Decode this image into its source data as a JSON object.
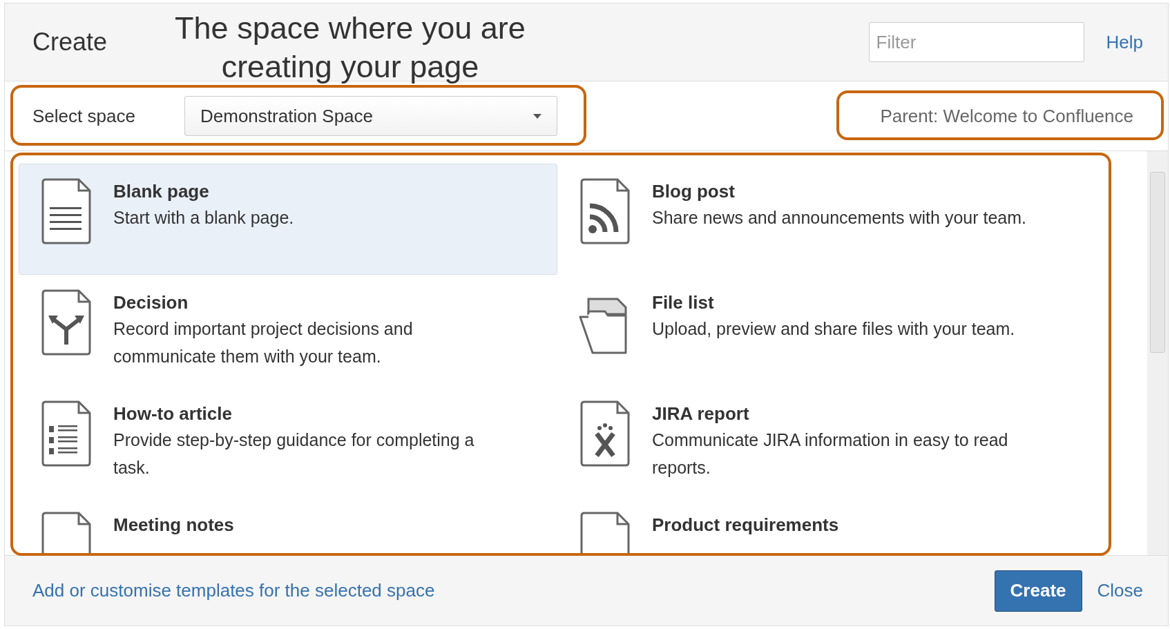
{
  "dialog": {
    "title": "Create",
    "filter": {
      "placeholder": "Filter"
    },
    "help": "Help"
  },
  "annotation": {
    "lines": [
      "The space where you are",
      "creating your page"
    ]
  },
  "space_row": {
    "label": "Select space",
    "space": "Demonstration Space",
    "parent": "Parent: Welcome to Confluence"
  },
  "templates": [
    {
      "title": "Blank page",
      "description": "Start with a blank page.",
      "selected": true
    },
    {
      "title": "Blog post",
      "description": "Share news and announcements with your team.",
      "selected": false
    },
    {
      "title": "Decision",
      "description": "Record important project decisions and communicate them with your team.",
      "selected": false
    },
    {
      "title": "File list",
      "description": "Upload, preview and share files with your team.",
      "selected": false
    },
    {
      "title": "How-to article",
      "description": "Provide step-by-step guidance for completing a task.",
      "selected": false
    },
    {
      "title": "JIRA report",
      "description": "Communicate JIRA information in easy to read reports.",
      "selected": false
    },
    {
      "title": "Meeting notes",
      "selected": false
    },
    {
      "title": "Product requirements",
      "selected": false
    }
  ],
  "footer": {
    "link": "Add or customise templates for the selected space",
    "primary": "Create",
    "close": "Close"
  }
}
